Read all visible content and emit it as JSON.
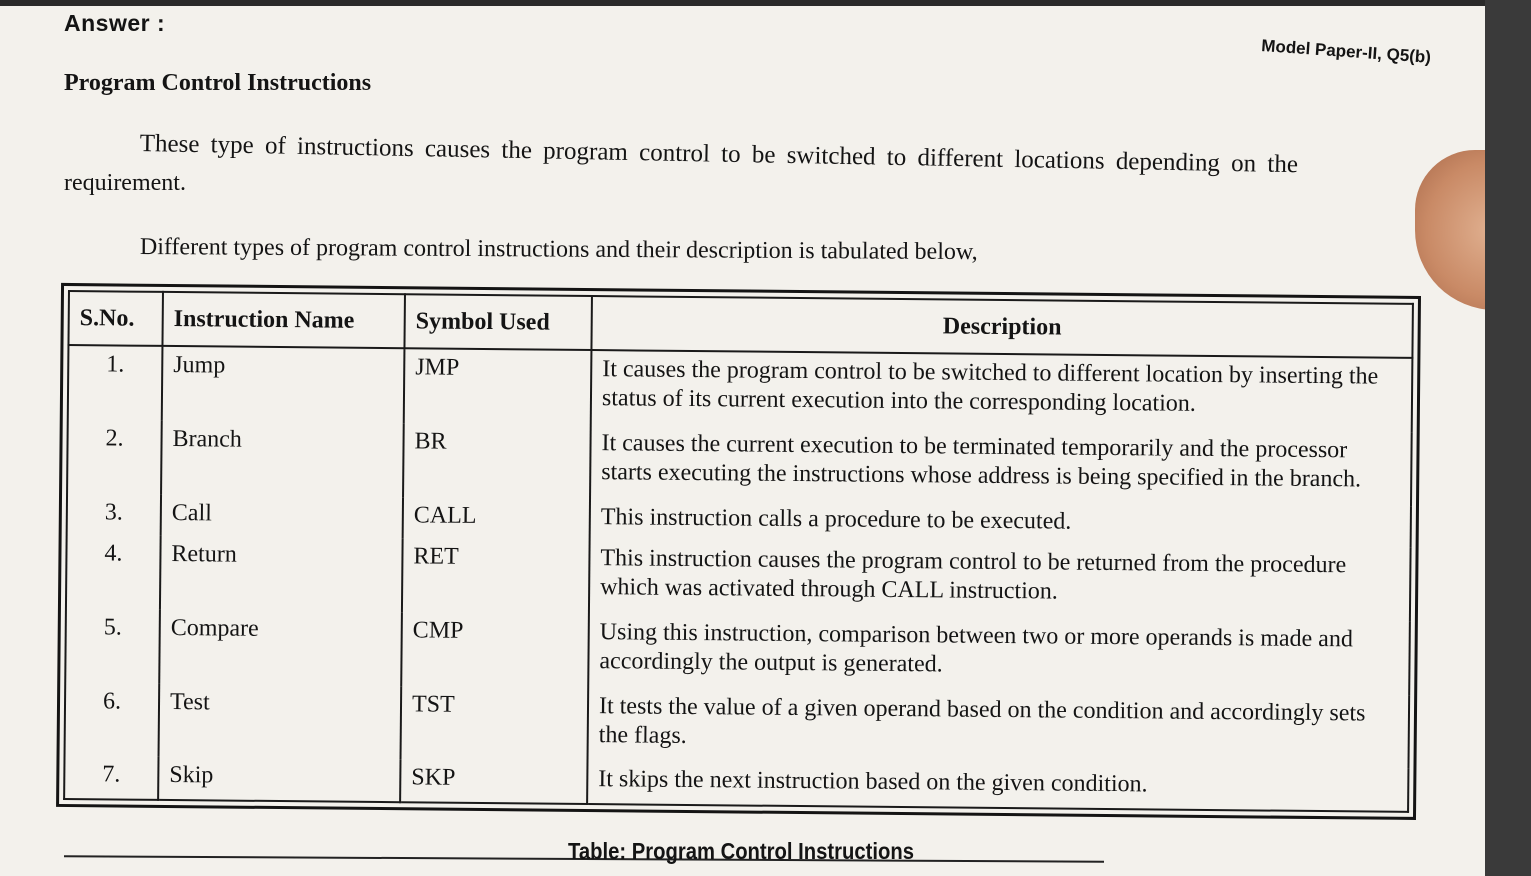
{
  "answer_label": "Answer :",
  "reference": "Model Paper-II, Q5(b)",
  "heading": "Program Control Instructions",
  "paragraph1": {
    "line1": "These type of instructions causes the program control to be switched to different locations depending on the",
    "line2": "requirement."
  },
  "paragraph2": "Different types of program control instructions and their description is tabulated below,",
  "table": {
    "headers": [
      "S.No.",
      "Instruction Name",
      "Symbol Used",
      "Description"
    ],
    "rows": [
      {
        "sno": "1.",
        "name": "Jump",
        "symbol": "JMP",
        "desc": "It causes the program control to be switched to different location by inserting the status of its current execution into the corresponding location."
      },
      {
        "sno": "2.",
        "name": "Branch",
        "symbol": "BR",
        "desc": "It causes the current execution to be terminated temporarily and the processor starts executing the instructions whose address is being specified in the branch."
      },
      {
        "sno": "3.",
        "name": "Call",
        "symbol": "CALL",
        "desc": "This instruction calls a procedure to be executed."
      },
      {
        "sno": "4.",
        "name": "Return",
        "symbol": "RET",
        "desc": "This instruction causes the program control to be returned from the procedure which was activated through CALL instruction."
      },
      {
        "sno": "5.",
        "name": "Compare",
        "symbol": "CMP",
        "desc": "Using this instruction, comparison between two or more operands is made and accordingly the output is generated."
      },
      {
        "sno": "6.",
        "name": "Test",
        "symbol": "TST",
        "desc": "It tests the value of a given operand based on the condition and accordingly sets the flags."
      },
      {
        "sno": "7.",
        "name": "Skip",
        "symbol": "SKP",
        "desc": "It skips the next instruction based on the given condition."
      }
    ]
  },
  "caption": "Table: Program Control Instructions"
}
